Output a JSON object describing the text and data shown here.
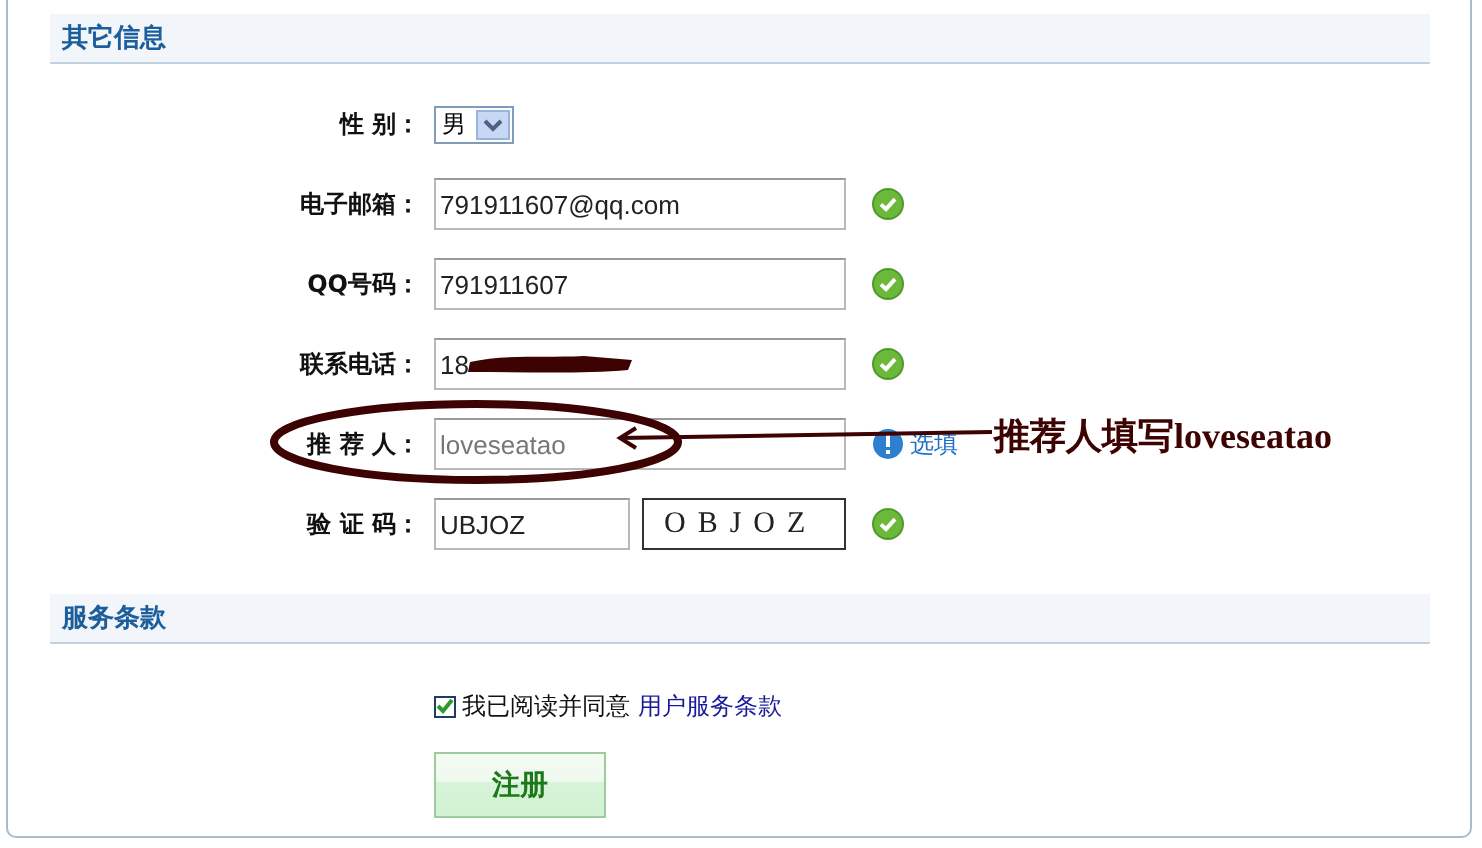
{
  "sections": [
    {
      "title": "其它信息",
      "fields": [
        {
          "kind": "select",
          "label": "性 别：",
          "value": "男"
        },
        {
          "kind": "text",
          "label": "电子邮箱：",
          "value": "791911607@qq.com",
          "valid": true
        },
        {
          "kind": "text",
          "label": "QQ号码：",
          "value": "791911607",
          "valid": true
        },
        {
          "kind": "text",
          "label": "联系电话：",
          "value": "18",
          "valid": true,
          "redacted": true
        },
        {
          "kind": "text",
          "label": "推 荐 人：",
          "placeholder": "loveseatao",
          "valid": false,
          "optional": true,
          "hint": "选填"
        },
        {
          "kind": "captcha",
          "label": "验 证 码：",
          "value": "UBJOZ",
          "captcha": "OBJOZ",
          "valid": true
        }
      ]
    },
    {
      "title": "服务条款",
      "agreement": {
        "checked": true,
        "text": "我已阅读并同意",
        "link": "用户服务条款"
      },
      "submit": "注册"
    }
  ],
  "annotation": {
    "text": "推荐人填写loveseatao"
  }
}
